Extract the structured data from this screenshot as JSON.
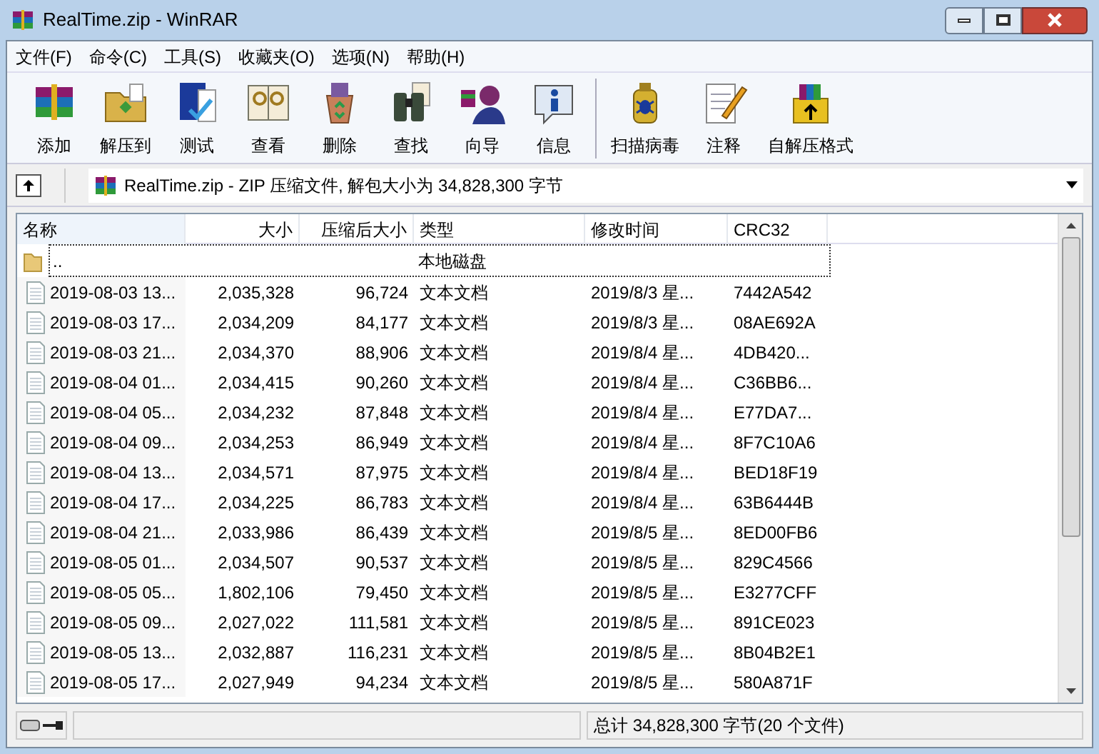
{
  "window": {
    "title": "RealTime.zip - WinRAR"
  },
  "menu": [
    "文件(F)",
    "命令(C)",
    "工具(S)",
    "收藏夹(O)",
    "选项(N)",
    "帮助(H)"
  ],
  "toolbar": [
    {
      "label": "添加",
      "kind": "add"
    },
    {
      "label": "解压到",
      "kind": "extract"
    },
    {
      "label": "测试",
      "kind": "test"
    },
    {
      "label": "查看",
      "kind": "view"
    },
    {
      "label": "删除",
      "kind": "delete"
    },
    {
      "label": "查找",
      "kind": "find"
    },
    {
      "label": "向导",
      "kind": "wizard"
    },
    {
      "label": "信息",
      "kind": "info"
    },
    {
      "label": "扫描病毒",
      "kind": "scan"
    },
    {
      "label": "注释",
      "kind": "comment"
    },
    {
      "label": "自解压格式",
      "kind": "sfx"
    }
  ],
  "address": {
    "text": "RealTime.zip - ZIP 压缩文件, 解包大小为 34,828,300 字节"
  },
  "table": {
    "columns": [
      "名称",
      "大小",
      "压缩后大小",
      "类型",
      "修改时间",
      "CRC32"
    ],
    "parent_row": {
      "name": "..",
      "type": "本地磁盘",
      "focused": true
    },
    "rows": [
      {
        "name": "2019-08-03 13...",
        "size": "2,035,328",
        "packed": "96,724",
        "type": "文本文档",
        "modified": "2019/8/3 星...",
        "crc": "7442A542"
      },
      {
        "name": "2019-08-03 17...",
        "size": "2,034,209",
        "packed": "84,177",
        "type": "文本文档",
        "modified": "2019/8/3 星...",
        "crc": "08AE692A"
      },
      {
        "name": "2019-08-03 21...",
        "size": "2,034,370",
        "packed": "88,906",
        "type": "文本文档",
        "modified": "2019/8/4 星...",
        "crc": "4DB420..."
      },
      {
        "name": "2019-08-04 01...",
        "size": "2,034,415",
        "packed": "90,260",
        "type": "文本文档",
        "modified": "2019/8/4 星...",
        "crc": "C36BB6..."
      },
      {
        "name": "2019-08-04 05...",
        "size": "2,034,232",
        "packed": "87,848",
        "type": "文本文档",
        "modified": "2019/8/4 星...",
        "crc": "E77DA7..."
      },
      {
        "name": "2019-08-04 09...",
        "size": "2,034,253",
        "packed": "86,949",
        "type": "文本文档",
        "modified": "2019/8/4 星...",
        "crc": "8F7C10A6"
      },
      {
        "name": "2019-08-04 13...",
        "size": "2,034,571",
        "packed": "87,975",
        "type": "文本文档",
        "modified": "2019/8/4 星...",
        "crc": "BED18F19"
      },
      {
        "name": "2019-08-04 17...",
        "size": "2,034,225",
        "packed": "86,783",
        "type": "文本文档",
        "modified": "2019/8/4 星...",
        "crc": "63B6444B"
      },
      {
        "name": "2019-08-04 21...",
        "size": "2,033,986",
        "packed": "86,439",
        "type": "文本文档",
        "modified": "2019/8/5 星...",
        "crc": "8ED00FB6"
      },
      {
        "name": "2019-08-05 01...",
        "size": "2,034,507",
        "packed": "90,537",
        "type": "文本文档",
        "modified": "2019/8/5 星...",
        "crc": "829C4566"
      },
      {
        "name": "2019-08-05 05...",
        "size": "1,802,106",
        "packed": "79,450",
        "type": "文本文档",
        "modified": "2019/8/5 星...",
        "crc": "E3277CFF"
      },
      {
        "name": "2019-08-05 09...",
        "size": "2,027,022",
        "packed": "111,581",
        "type": "文本文档",
        "modified": "2019/8/5 星...",
        "crc": "891CE023"
      },
      {
        "name": "2019-08-05 13...",
        "size": "2,032,887",
        "packed": "116,231",
        "type": "文本文档",
        "modified": "2019/8/5 星...",
        "crc": "8B04B2E1"
      },
      {
        "name": "2019-08-05 17...",
        "size": "2,027,949",
        "packed": "94,234",
        "type": "文本文档",
        "modified": "2019/8/5 星...",
        "crc": "580A871F"
      }
    ]
  },
  "status_bar": {
    "total": "总计 34,828,300 字节(20 个文件)"
  }
}
